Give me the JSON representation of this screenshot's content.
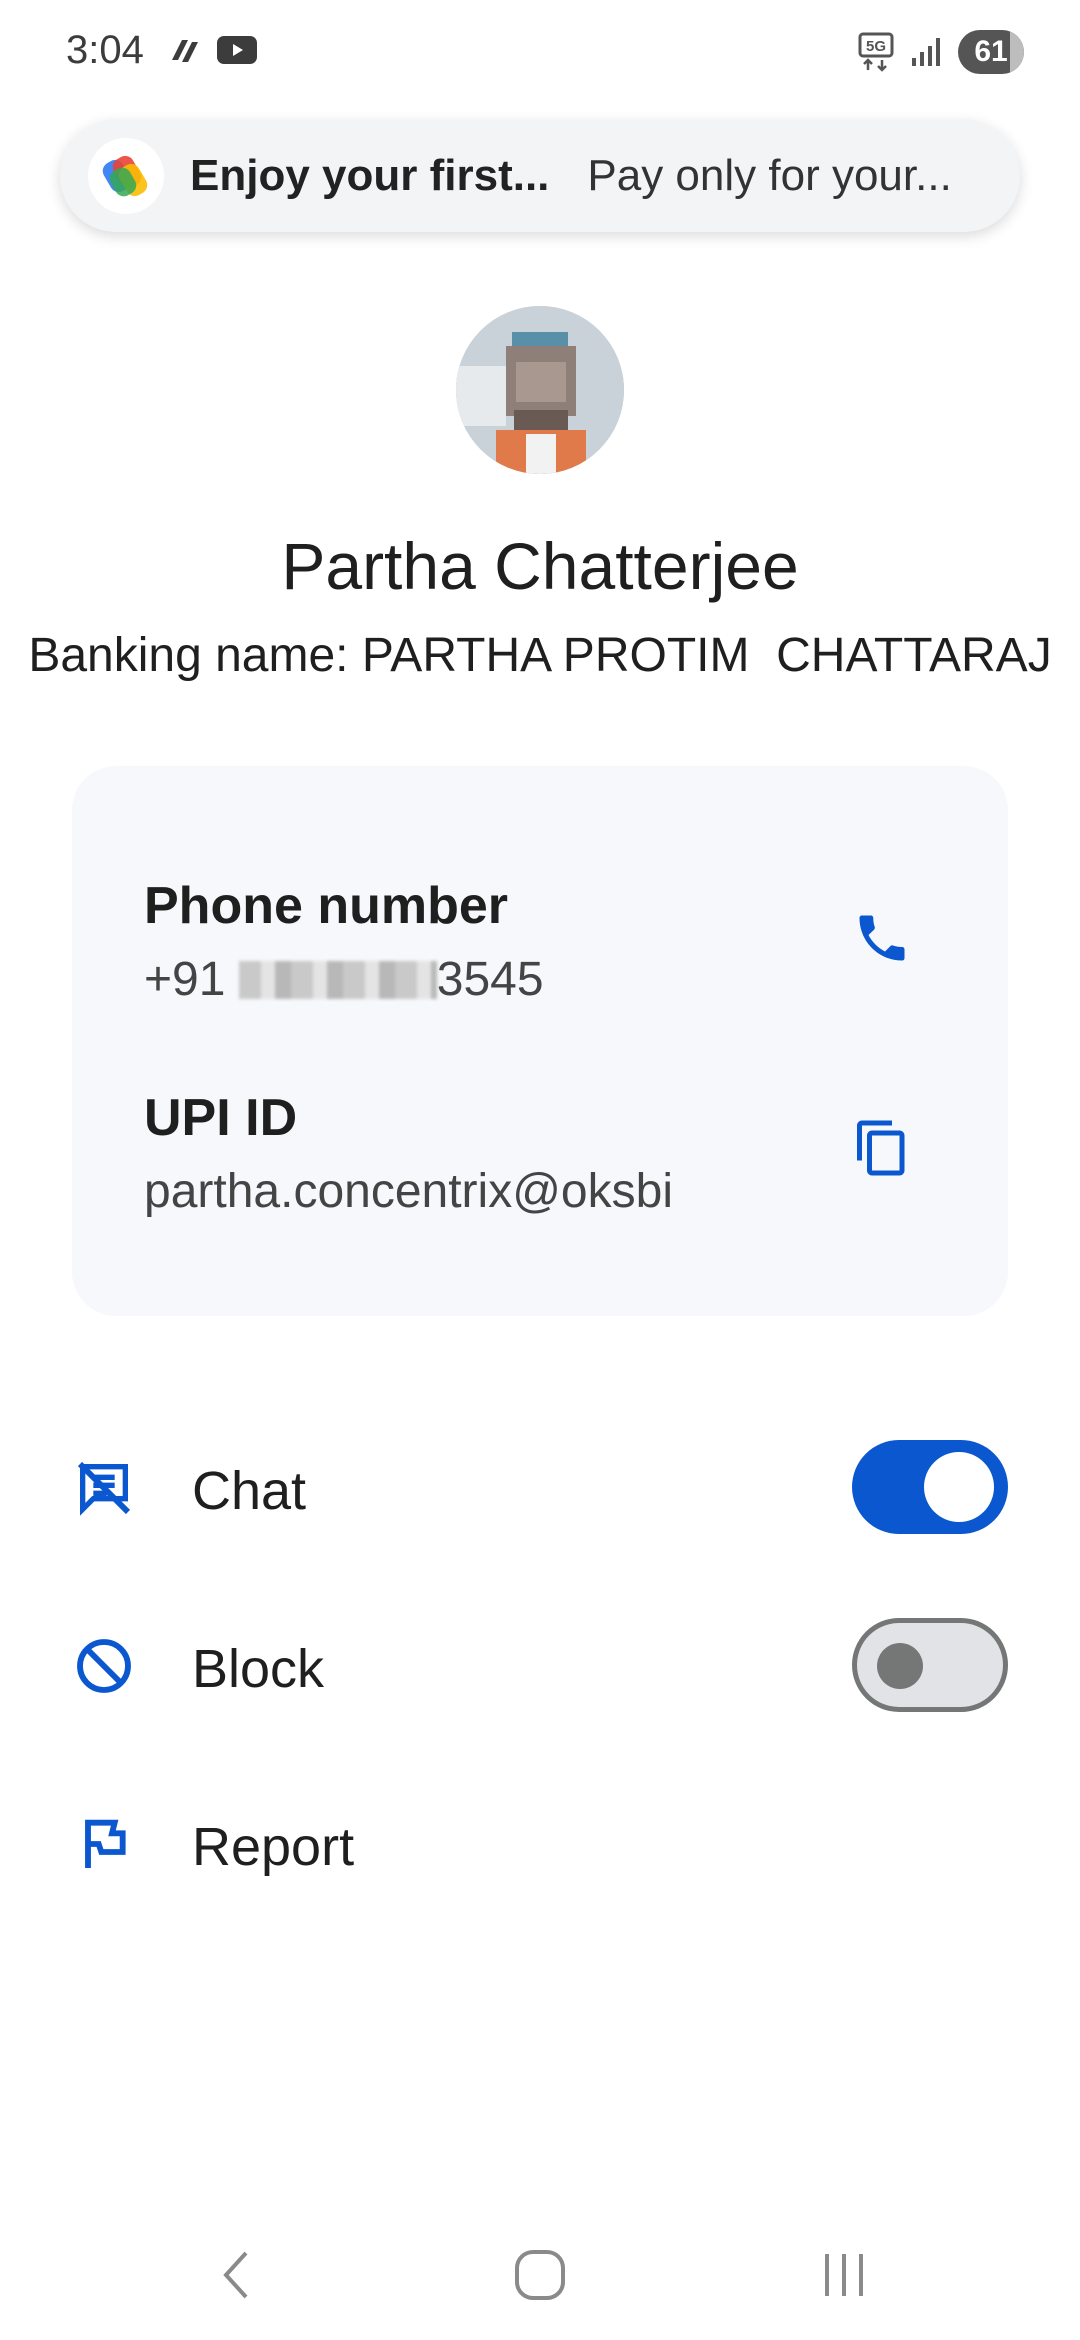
{
  "status_bar": {
    "time": "3:04",
    "network": "5G",
    "battery": "61",
    "icons": [
      "infinity-app-icon",
      "youtube-icon",
      "signal-icon",
      "battery-icon"
    ]
  },
  "promo": {
    "title": "Enjoy your first...",
    "subtitle": "Pay only for your...",
    "icon": "google-pay-logo"
  },
  "contact": {
    "name": "Partha Chatterjee",
    "banking_name": "Banking name: PARTHA PROTIM  CHATTARAJ"
  },
  "details": {
    "phone": {
      "title": "Phone number",
      "prefix": "+91 ",
      "suffix": "3545",
      "icon": "phone-icon"
    },
    "upi": {
      "title": "UPI ID",
      "value": "partha.concentrix@oksbi",
      "icon": "copy-icon"
    }
  },
  "settings": {
    "chat": {
      "label": "Chat",
      "enabled": true,
      "icon": "chat-off-icon"
    },
    "block": {
      "label": "Block",
      "enabled": false,
      "icon": "block-icon"
    },
    "report": {
      "label": "Report",
      "icon": "flag-icon"
    }
  },
  "colors": {
    "accent": "#0b57d0",
    "card_bg": "#f6f8fc",
    "toggle_off_track": "#e1e3e6",
    "toggle_off_outline": "#747775"
  },
  "nav": [
    "back",
    "home",
    "recents"
  ]
}
